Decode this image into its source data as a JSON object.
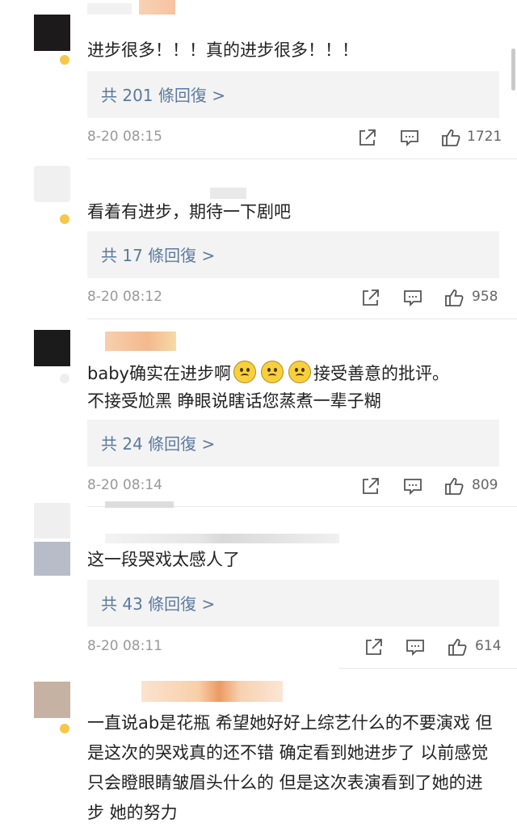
{
  "comments": [
    {
      "text": "进步很多！！！真的进步很多！！！",
      "reply_label": "共 201 條回復 >",
      "time": "8-20 08:15",
      "likes": "1721"
    },
    {
      "text": "看着有进步，期待一下剧吧",
      "reply_label": "共 17 條回復 >",
      "time": "8-20 08:12",
      "likes": "958"
    },
    {
      "text_line1_pre": "baby确实在进步啊",
      "text_line1_post": "接受善意的批评。",
      "text_line2": "不接受尬黑 睁眼说瞎话您蒸煮一辈子糊",
      "reply_label": "共 24 條回復 >",
      "time": "8-20 08:14",
      "likes": "809"
    },
    {
      "text": "这一段哭戏太感人了",
      "reply_label": "共 43 條回復 >",
      "time": "8-20 08:11",
      "likes": "614"
    },
    {
      "text": "一直说ab是花瓶 希望她好好上综艺什么的不要演戏 但是这次的哭戏真的还不错 确定看到她进步了 以前感觉只会瞪眼睛皱眉头什么的 但是这次表演看到了她的进步 她的努力"
    }
  ],
  "icons": {
    "share": "share-icon",
    "comment": "comment-icon",
    "like": "thumbs-up-icon",
    "vip": "vip-badge-icon",
    "emoji": "worried-face-emoji"
  },
  "colors": {
    "reply_link": "#5b7a9e",
    "reply_bg": "#f3f3f3",
    "meta_gray": "#999999",
    "badge": "#f5c84a"
  }
}
